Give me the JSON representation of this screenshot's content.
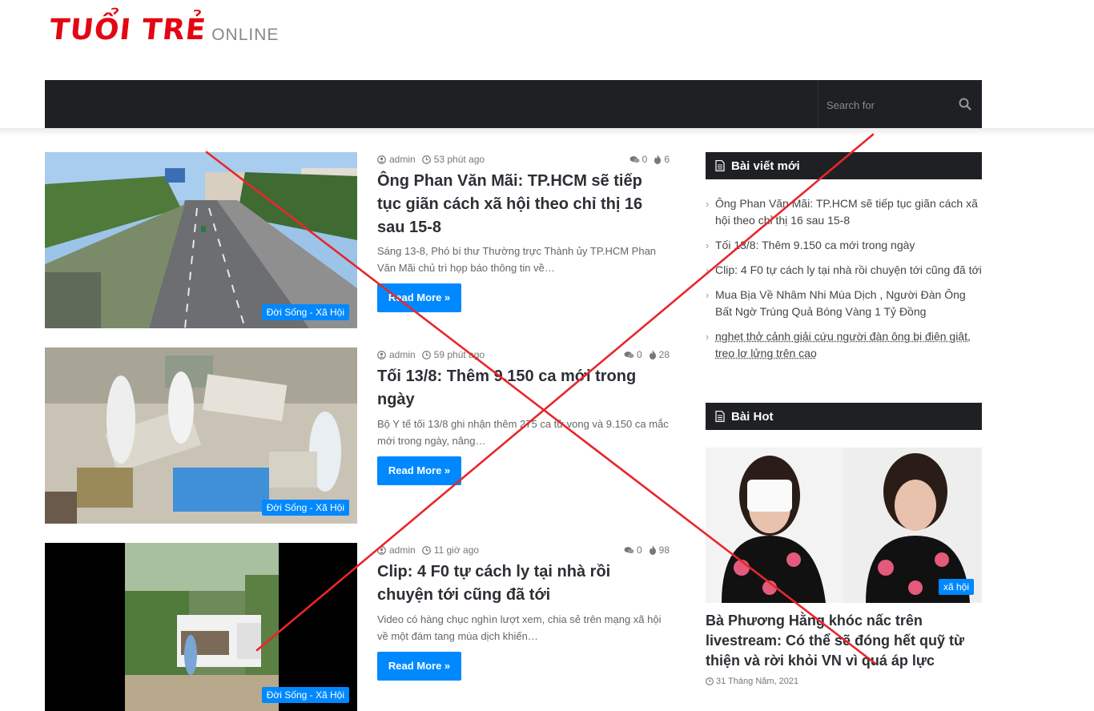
{
  "header": {
    "logo_main": "TUỔI TRẺ",
    "logo_sub": "ONLINE",
    "search_placeholder": "Search for"
  },
  "posts": [
    {
      "author": "admin",
      "time": "53 phút ago",
      "comments": "0",
      "views": "6",
      "title": "Ông Phan Văn Mãi: TP.HCM sẽ tiếp tục giãn cách xã hội theo chỉ thị 16 sau 15-8",
      "excerpt": "Sáng 13-8, Phó bí thư Thường trực Thành ủy TP.HCM Phan Văn Mãi chủ trì họp báo thông tin về…",
      "category": "Đời Sống - Xã Hội",
      "read_more": "Read More »"
    },
    {
      "author": "admin",
      "time": "59 phút ago",
      "comments": "0",
      "views": "28",
      "title": "Tối 13/8: Thêm 9.150 ca mới trong ngày",
      "excerpt": "Bộ Y tế tối 13/8 ghi nhận thêm 275 ca tử vong và 9.150 ca mắc mới trong ngày, nâng…",
      "category": "Đời Sống - Xã Hội",
      "read_more": "Read More »"
    },
    {
      "author": "admin",
      "time": "11 giờ ago",
      "comments": "0",
      "views": "98",
      "title": "Clip: 4 F0 tự cách ly tại nhà rồi chuyện tới cũng đã tới",
      "excerpt": "Video có hàng chục nghìn lượt xem, chia sẻ trên mạng xã hội về một đám tang mùa dịch khiến…",
      "category": "Đời Sống - Xã Hội",
      "read_more": "Read More »"
    }
  ],
  "sidebar": {
    "recent_title": "Bài viết mới",
    "recent": [
      "Ông Phan Văn Mãi: TP.HCM sẽ tiếp tục giãn cách xã hội theo chỉ thị 16 sau 15-8",
      "Tối 13/8: Thêm 9.150 ca mới trong ngày",
      "Clip: 4 F0 tự cách ly tại nhà rồi chuyện tới cũng đã tới",
      "Mua Bịa Về Nhâm Nhi Mùa Dịch , Người Đàn Ông Bất Ngờ Trúng Quả Bóng Vàng 1 Tỷ Đồng",
      "nghẹt thở cảnh giải cứu người đàn ông bị điện giật, treo lơ lửng trên cao"
    ],
    "hot_title": "Bài Hot",
    "hot_post": {
      "title": "Bà Phương Hằng khóc nấc trên livestream: Có thể sẽ đóng hết quỹ từ thiện và rời khỏi VN vì quá áp lực",
      "category": "xã hội",
      "date": "31 Tháng Năm, 2021"
    }
  },
  "colors": {
    "brand": "#e30613",
    "accent": "#0088ff",
    "nav": "#1f2024",
    "overlay_cross": "#e8262a"
  }
}
